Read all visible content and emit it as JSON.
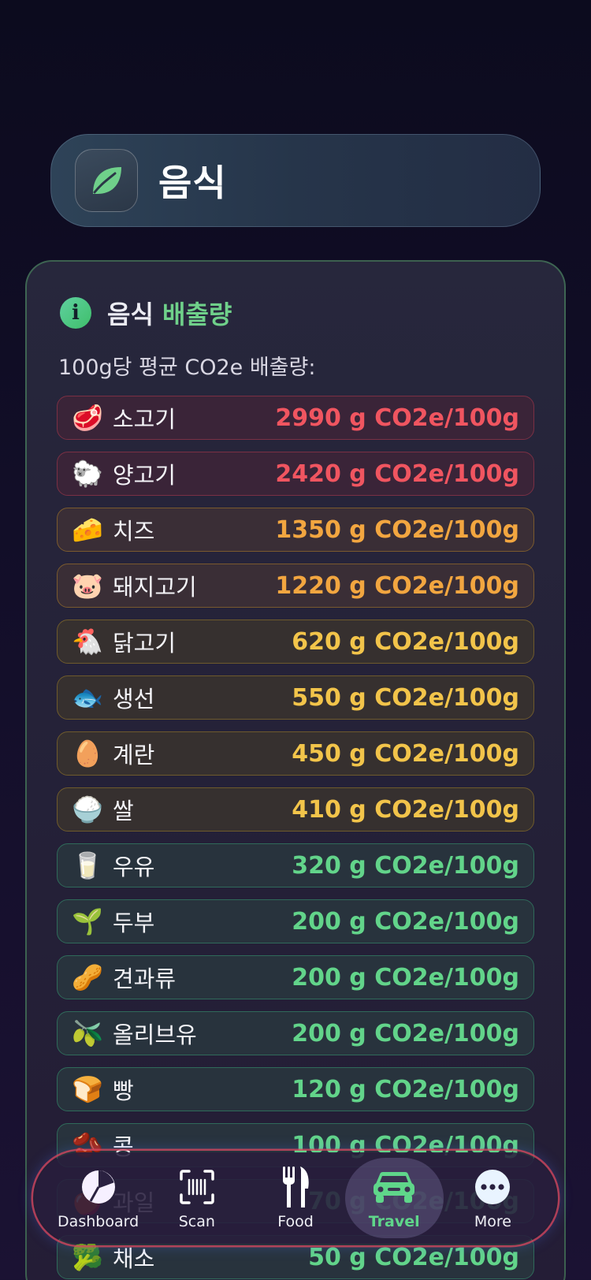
{
  "header": {
    "title": "음식",
    "icon": "leaf-icon"
  },
  "card": {
    "title_main": "음식",
    "title_accent": "배출량",
    "subtitle": "100g당 평균 CO2e 배출량:",
    "items": [
      {
        "emoji": "🥩",
        "name": "소고기",
        "value": "2990 g CO2e/100g",
        "tone": "red"
      },
      {
        "emoji": "🐑",
        "name": "양고기",
        "value": "2420 g CO2e/100g",
        "tone": "red"
      },
      {
        "emoji": "🧀",
        "name": "치즈",
        "value": "1350 g CO2e/100g",
        "tone": "amber"
      },
      {
        "emoji": "🐷",
        "name": "돼지고기",
        "value": "1220 g CO2e/100g",
        "tone": "amber"
      },
      {
        "emoji": "🐔",
        "name": "닭고기",
        "value": "620 g CO2e/100g",
        "tone": "yellow"
      },
      {
        "emoji": "🐟",
        "name": "생선",
        "value": "550 g CO2e/100g",
        "tone": "yellow"
      },
      {
        "emoji": "🥚",
        "name": "계란",
        "value": "450 g CO2e/100g",
        "tone": "yellow"
      },
      {
        "emoji": "🍚",
        "name": "쌀",
        "value": "410 g CO2e/100g",
        "tone": "yellow"
      },
      {
        "emoji": "🥛",
        "name": "우유",
        "value": "320 g CO2e/100g",
        "tone": "green"
      },
      {
        "emoji": "🌱",
        "name": "두부",
        "value": "200 g CO2e/100g",
        "tone": "green"
      },
      {
        "emoji": "🥜",
        "name": "견과류",
        "value": "200 g CO2e/100g",
        "tone": "green"
      },
      {
        "emoji": "🫒",
        "name": "올리브유",
        "value": "200 g CO2e/100g",
        "tone": "green"
      },
      {
        "emoji": "🍞",
        "name": "빵",
        "value": "120 g CO2e/100g",
        "tone": "green"
      },
      {
        "emoji": "🫘",
        "name": "콩",
        "value": "100 g CO2e/100g",
        "tone": "green"
      },
      {
        "emoji": "🍎",
        "name": "과일",
        "value": "70 g CO2e/100g",
        "tone": "green"
      },
      {
        "emoji": "🥦",
        "name": "채소",
        "value": "50 g CO2e/100g",
        "tone": "green"
      }
    ]
  },
  "tabbar": {
    "tabs": [
      {
        "label": "Dashboard",
        "icon": "pie-chart-icon",
        "active": false
      },
      {
        "label": "Scan",
        "icon": "barcode-scan-icon",
        "active": false
      },
      {
        "label": "Food",
        "icon": "fork-knife-icon",
        "active": false
      },
      {
        "label": "Travel",
        "icon": "car-icon",
        "active": true
      },
      {
        "label": "More",
        "icon": "more-dots-icon",
        "active": false
      }
    ]
  }
}
